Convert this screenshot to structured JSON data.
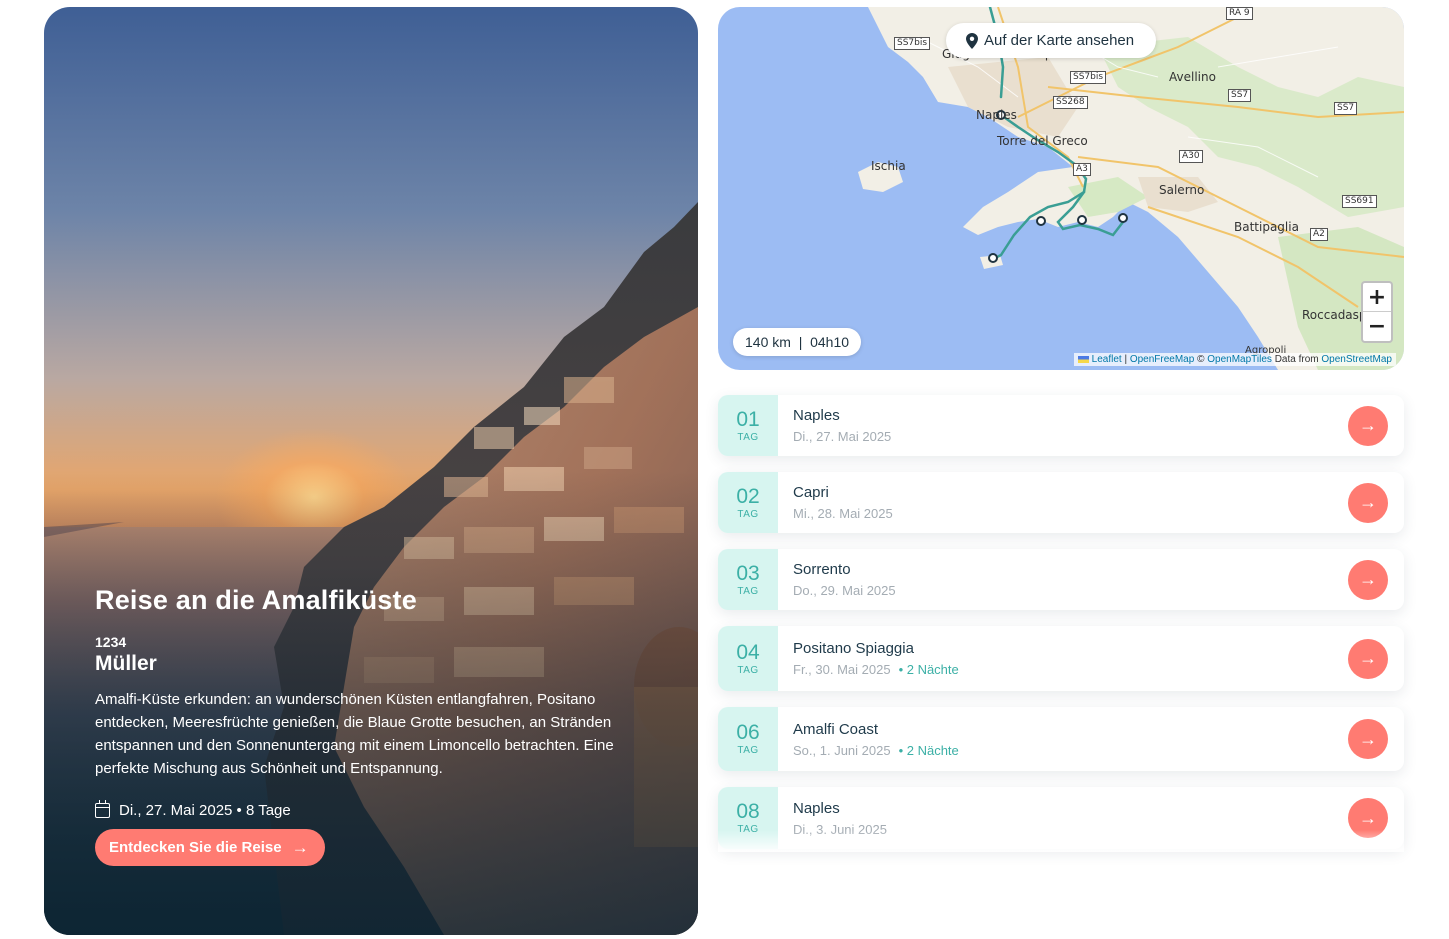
{
  "hero": {
    "title": "Reise an die Amalfiküste",
    "code": "1234",
    "name": "Müller",
    "description": "Amalfi-Küste erkunden: an wunderschönen Küsten entlangfahren, Positano entdecken, Meeresfrüchte genießen, die Blaue Grotte besuchen, an Stränden entspannen und den Sonnenuntergang mit einem Limoncello betrachten. Eine perfekte Mischung aus Schönheit und Entspannung.",
    "date_info": "Di., 27. Mai 2025 • 8 Tage",
    "button_label": "Entdecken Sie die Reise"
  },
  "map": {
    "view_button": "Auf der Karte ansehen",
    "distance": "140 km  |  04h10",
    "zoom_in": "+",
    "zoom_out": "−",
    "attribution": {
      "leaflet": "Leaflet",
      "sep1": " | ",
      "openfreemap": "OpenFreeMap",
      "copy": " © ",
      "openmaptiles": "OpenMapTiles",
      "data_from": " Data from ",
      "osm": "OpenStreetMap"
    },
    "places": [
      "Giugliano in Campania",
      "Avellino",
      "Naples",
      "Torre del Greco",
      "Ischia",
      "Salerno",
      "Battipaglia",
      "Roccadaspide",
      "Agropoli"
    ],
    "roads": [
      "RA 9",
      "SS7bis",
      "SS7bis",
      "SS268",
      "SS7",
      "SS7",
      "A30",
      "A3",
      "SS691",
      "A2"
    ],
    "route_color": "#3a9e94"
  },
  "days": [
    {
      "num": "01",
      "tag": "TAG",
      "city": "Naples",
      "date": "Di., 27. Mai 2025",
      "nights": ""
    },
    {
      "num": "02",
      "tag": "TAG",
      "city": "Capri",
      "date": "Mi., 28. Mai 2025",
      "nights": ""
    },
    {
      "num": "03",
      "tag": "TAG",
      "city": "Sorrento",
      "date": "Do., 29. Mai 2025",
      "nights": ""
    },
    {
      "num": "04",
      "tag": "TAG",
      "city": "Positano Spiaggia",
      "date": "Fr., 30. Mai 2025",
      "nights": "• 2 Nächte"
    },
    {
      "num": "06",
      "tag": "TAG",
      "city": "Amalfi Coast",
      "date": "So., 1. Juni 2025",
      "nights": "• 2 Nächte"
    },
    {
      "num": "08",
      "tag": "TAG",
      "city": "Naples",
      "date": "Di., 3. Juni 2025",
      "nights": ""
    }
  ],
  "colors": {
    "accent": "#ff7b72",
    "teal": "#3cb0a6",
    "teal_bg": "#d7f5f0"
  }
}
